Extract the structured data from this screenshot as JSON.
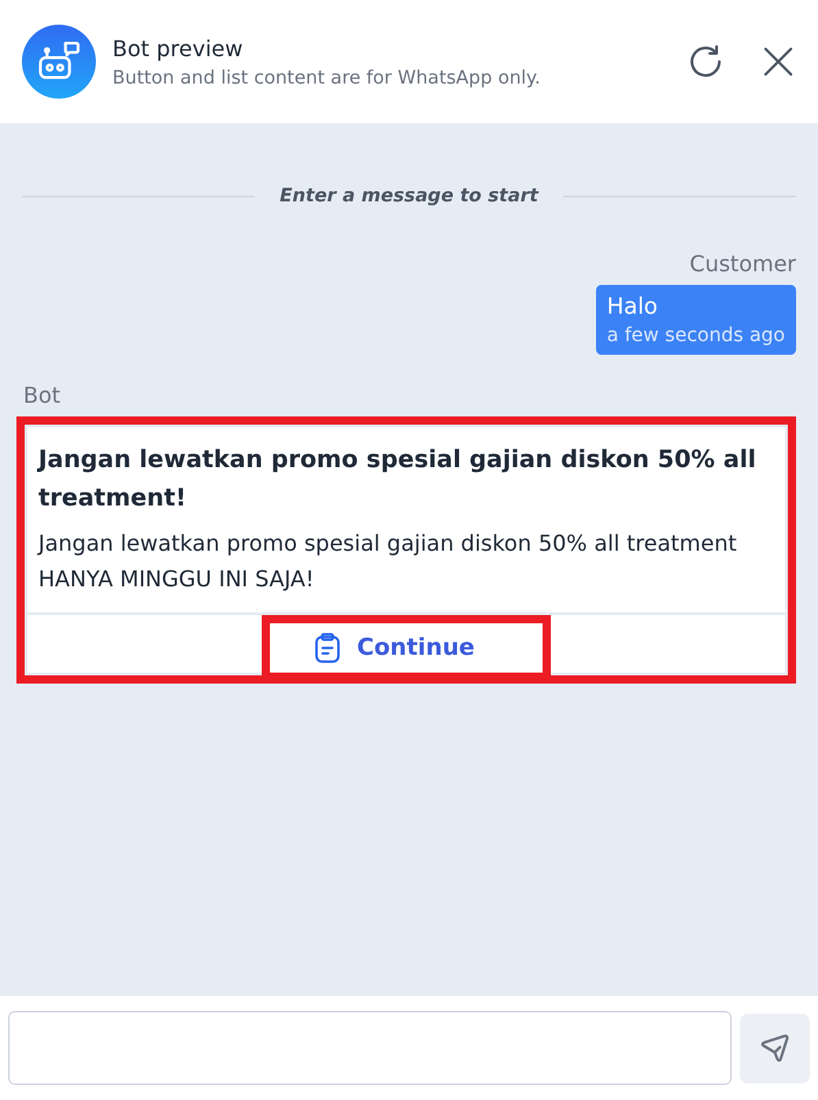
{
  "header": {
    "title": "Bot preview",
    "subtitle": "Button and list content are for WhatsApp only."
  },
  "divider": "Enter a message to start",
  "messages": [
    {
      "kind": "customer",
      "sender": "Customer",
      "text": "Halo",
      "time": "a few seconds ago"
    },
    {
      "kind": "bot",
      "sender": "Bot",
      "title": "Jangan lewatkan promo spesial gajian diskon 50% all treatment!",
      "body": "Jangan lewatkan promo spesial gajian diskon 50% all treatment HANYA MINGGU INI SAJA!",
      "highlighted": true,
      "button": {
        "label": "Continue",
        "highlighted": true
      }
    }
  ]
}
